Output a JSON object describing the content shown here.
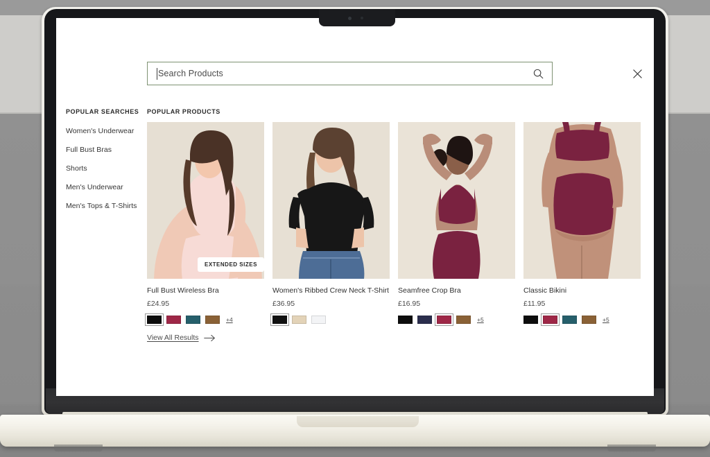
{
  "device": {
    "type": "laptop-mockup",
    "camera_icon": "camera-dot"
  },
  "search": {
    "placeholder": "Search Products",
    "value": "",
    "search_icon": "search-icon",
    "close_icon": "close-icon",
    "border_color": "#7e9272"
  },
  "sidebar": {
    "heading": "POPULAR SEARCHES",
    "items": [
      {
        "label": "Women's Underwear"
      },
      {
        "label": "Full Bust Bras"
      },
      {
        "label": "Shorts"
      },
      {
        "label": "Men's Underwear"
      },
      {
        "label": "Men's Tops & T-Shirts"
      }
    ]
  },
  "products": {
    "heading": "POPULAR PRODUCTS",
    "items": [
      {
        "title": "Full Bust Wireless Bra",
        "price": "£24.95",
        "badge": "EXTENDED SIZES",
        "image_alt": "Model wearing pale pink wireless bra and briefs on beige backdrop",
        "swatches": [
          {
            "name": "black",
            "hex": "#0d0d0d",
            "selected": true
          },
          {
            "name": "crimson",
            "hex": "#9e2747",
            "selected": false
          },
          {
            "name": "teal",
            "hex": "#265f6b",
            "selected": false
          },
          {
            "name": "brown",
            "hex": "#8a6136",
            "selected": false
          }
        ],
        "more_label": "+4"
      },
      {
        "title": "Women's Ribbed Crew Neck T-Shirt",
        "price": "£36.95",
        "badge": "",
        "image_alt": "Model wearing black ribbed crew neck t-shirt with blue jeans",
        "swatches": [
          {
            "name": "black",
            "hex": "#111111",
            "selected": true
          },
          {
            "name": "sand",
            "hex": "#e3d3b8",
            "selected": false
          },
          {
            "name": "white",
            "hex": "#f3f4f6",
            "selected": false
          }
        ],
        "more_label": ""
      },
      {
        "title": "Seamfree Crop Bra",
        "price": "£16.95",
        "badge": "",
        "image_alt": "Back view of model in burgundy crop bra and high waist briefs",
        "swatches": [
          {
            "name": "black",
            "hex": "#0d0d0d",
            "selected": false
          },
          {
            "name": "navy",
            "hex": "#2b2e4d",
            "selected": false
          },
          {
            "name": "crimson",
            "hex": "#9e2747",
            "selected": true
          },
          {
            "name": "brown",
            "hex": "#8a6136",
            "selected": false
          }
        ],
        "more_label": "+5"
      },
      {
        "title": "Classic Bikini",
        "price": "£11.95",
        "badge": "",
        "image_alt": "Back view of model in burgundy classic bikini briefs",
        "swatches": [
          {
            "name": "black",
            "hex": "#0d0d0d",
            "selected": false
          },
          {
            "name": "crimson",
            "hex": "#9e2747",
            "selected": true
          },
          {
            "name": "teal",
            "hex": "#265f6b",
            "selected": false
          },
          {
            "name": "brown",
            "hex": "#8a6136",
            "selected": false
          }
        ],
        "more_label": "+5"
      }
    ]
  },
  "footer": {
    "view_all_label": "View All Results",
    "arrow_icon": "arrow-right-icon"
  }
}
